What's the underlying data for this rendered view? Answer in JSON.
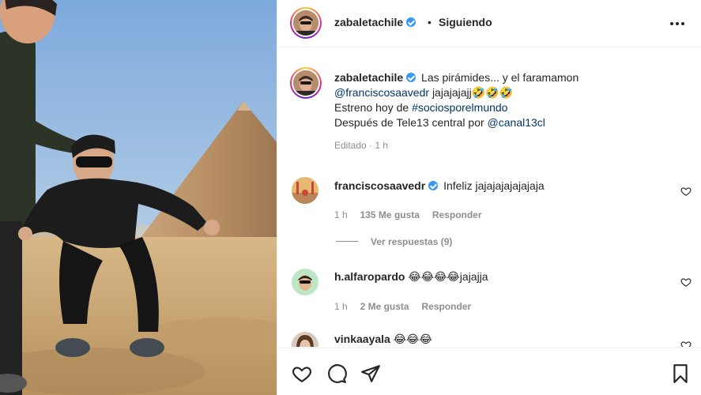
{
  "post": {
    "username": "zabaletachile",
    "follow_separator": "•",
    "follow_status": "Siguiendo"
  },
  "caption": {
    "username": "zabaletachile",
    "text_line1": "Las pirámides... y el faramamon",
    "mention1": "@franciscosaavedr",
    "text_line2": "jajajajajj🤣🤣🤣",
    "line3_prefix": "Estreno hoy de ",
    "hashtag": "#sociosporelmundo",
    "line4_prefix": "Después de Tele13 central por ",
    "mention2": "@canal13cl",
    "meta": "Editado · 1 h"
  },
  "comments": [
    {
      "username": "franciscosaavedr",
      "verified": true,
      "text": "Infeliz jajajajajajajaja",
      "time": "1 h",
      "likes": "135 Me gusta",
      "reply": "Responder",
      "view_replies": "Ver respuestas (9)"
    },
    {
      "username": "h.alfaropardo",
      "verified": false,
      "text": "😂😂😂😂jajajja",
      "time": "1 h",
      "likes": "2 Me gusta",
      "reply": "Responder"
    },
    {
      "username": "vinkaayala",
      "verified": false,
      "text": "😂😂😂"
    }
  ],
  "actions": {
    "like_icon": "heart-icon",
    "comment_icon": "comment-icon",
    "share_icon": "paper-plane-icon",
    "save_icon": "bookmark-icon"
  },
  "colors": {
    "link": "#00376b",
    "verified": "#3897f0",
    "muted": "#8e8e8e",
    "text": "#262626",
    "sky": "#8fb6df",
    "sand": "#c8a574"
  }
}
